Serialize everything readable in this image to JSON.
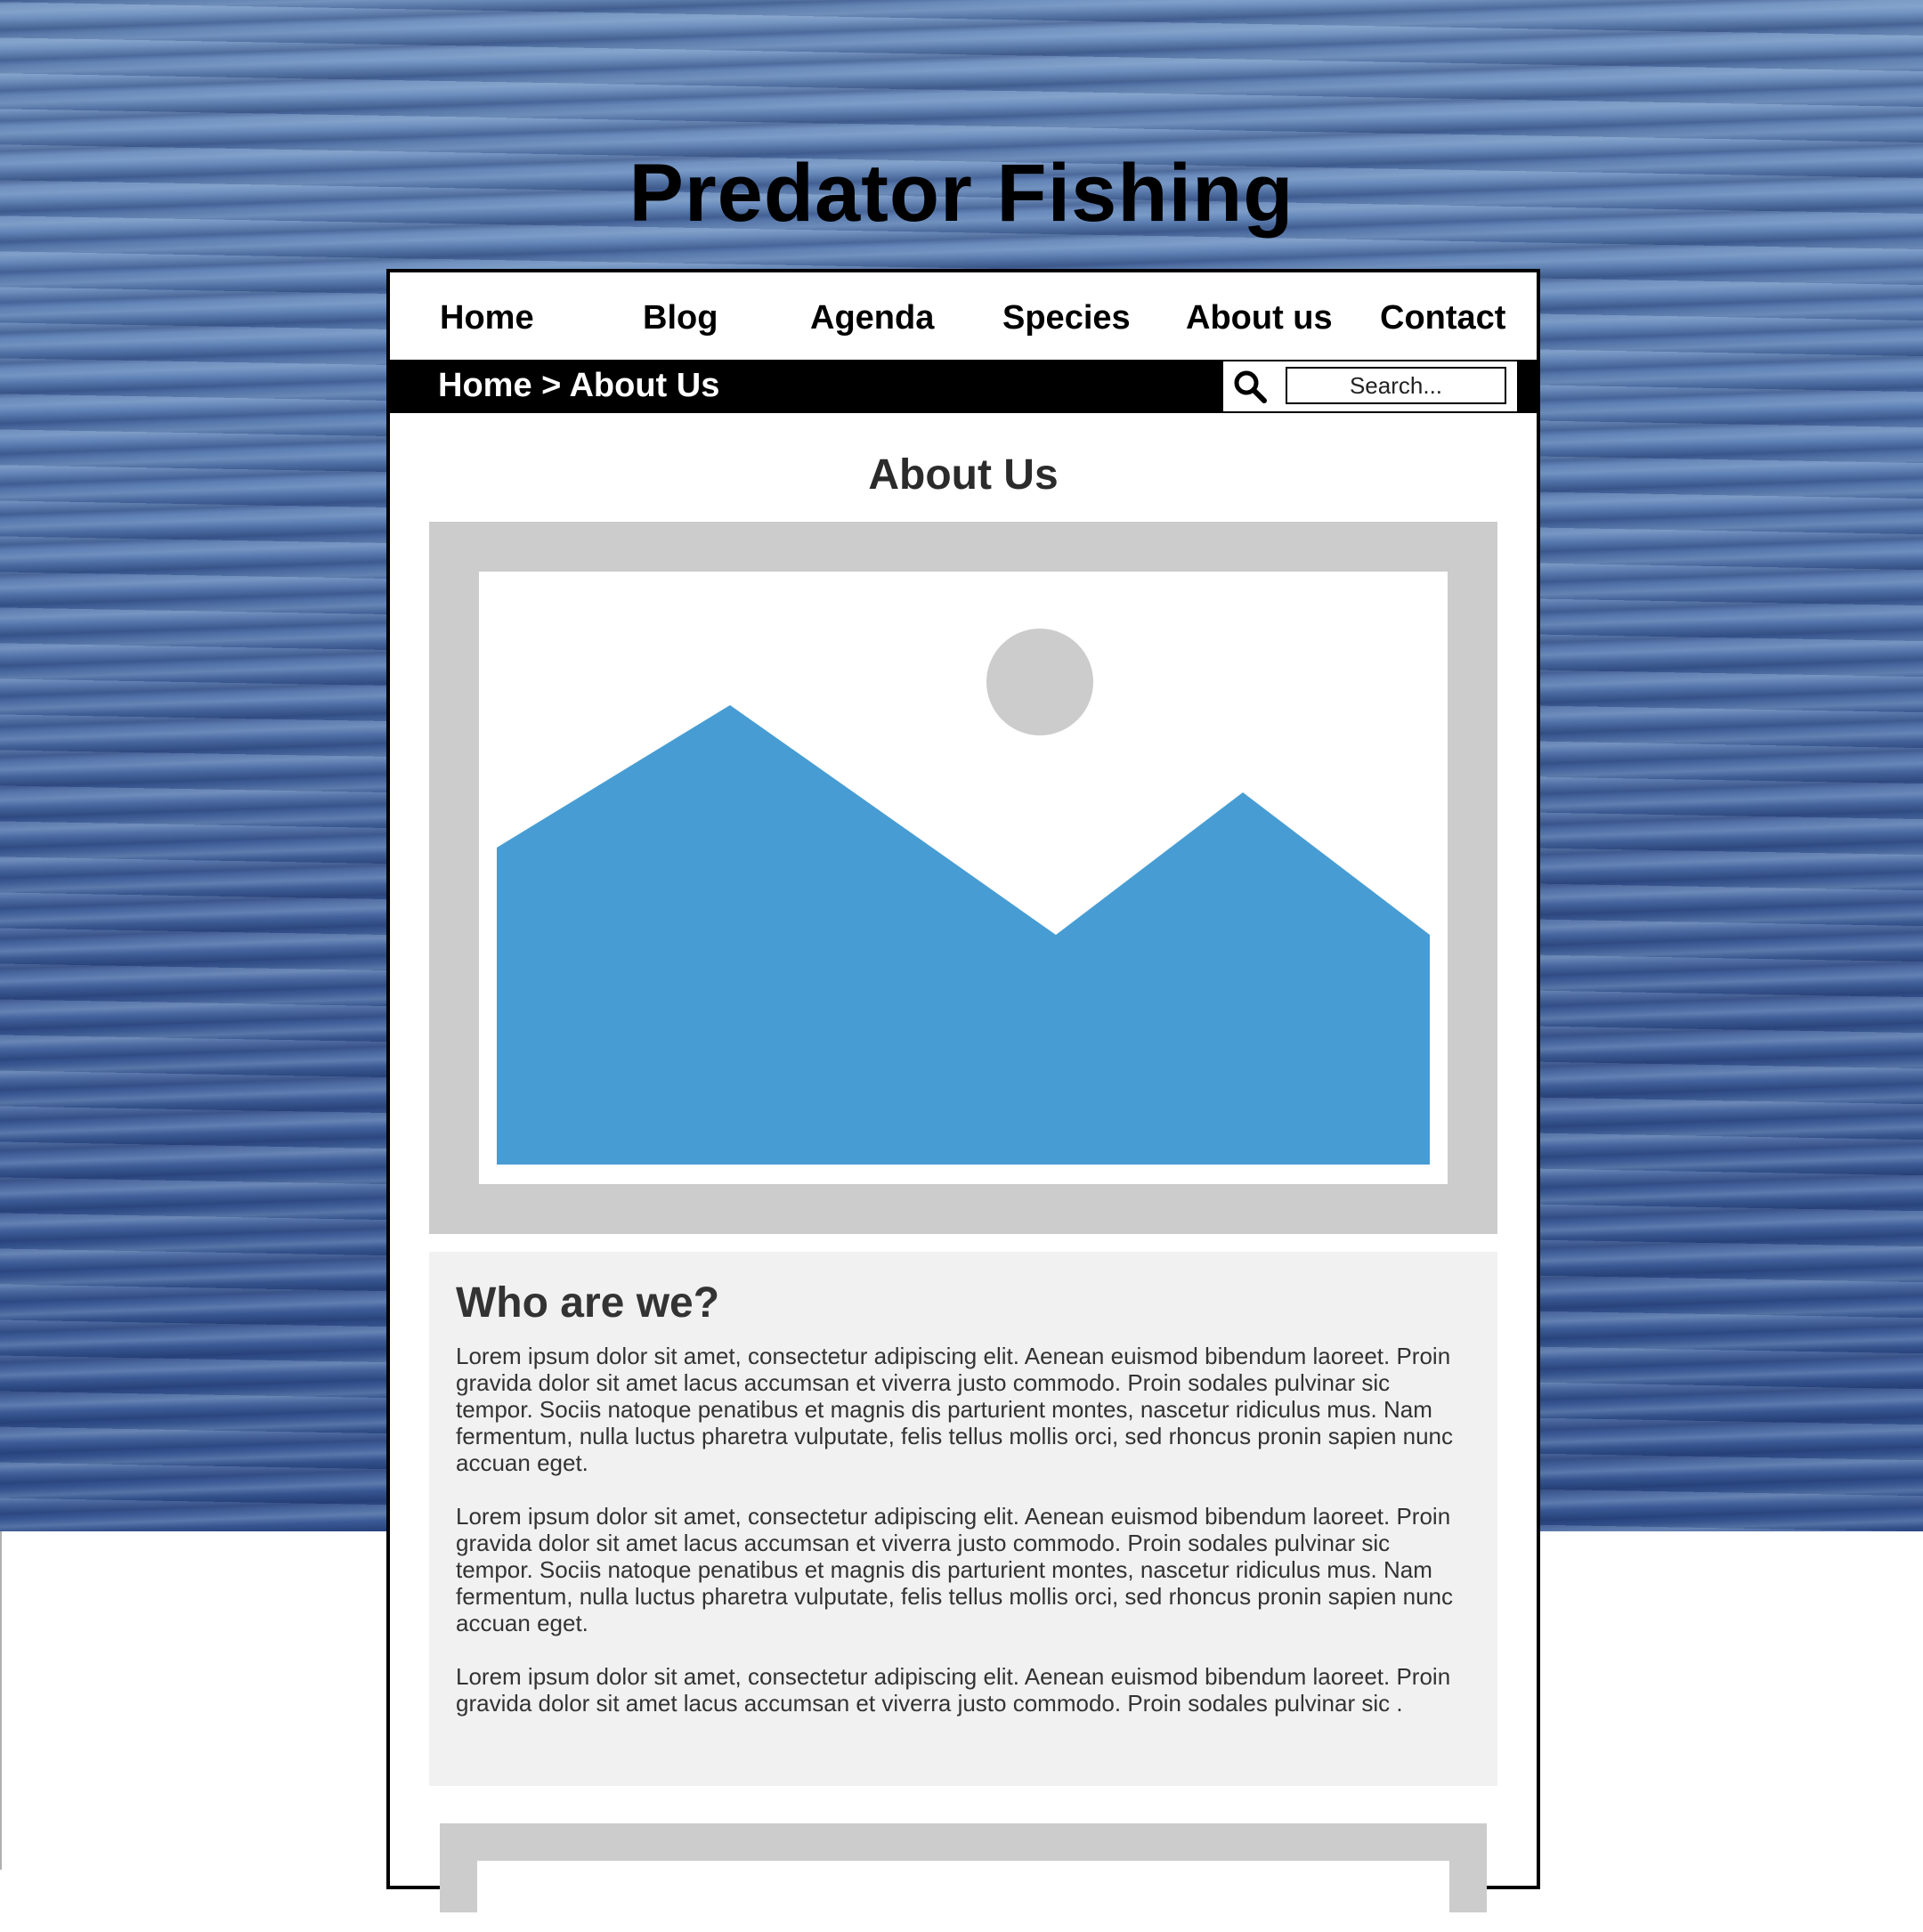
{
  "site": {
    "title": "Predator Fishing"
  },
  "nav": {
    "items": [
      {
        "label": "Home"
      },
      {
        "label": "Blog"
      },
      {
        "label": "Agenda"
      },
      {
        "label": "Species"
      },
      {
        "label": "About us"
      },
      {
        "label": "Contact"
      }
    ]
  },
  "breadcrumb": {
    "text": "Home > About Us"
  },
  "search": {
    "placeholder": "Search...",
    "icon": "magnifier"
  },
  "page": {
    "heading": "About Us",
    "hero_image": {
      "kind": "image-placeholder",
      "colors": {
        "frame": "#cccccc",
        "mountains": "#479dd3",
        "sun": "#cccccc"
      }
    }
  },
  "about": {
    "heading": "Who are we?",
    "paragraphs": [
      "Lorem ipsum dolor sit amet, consectetur adipiscing elit. Aenean euismod bibendum laoreet. Proin gravida dolor sit amet lacus accumsan et viverra justo commodo. Proin sodales pulvinar sic tempor. Sociis natoque penatibus et magnis dis parturient montes, nascetur ridiculus mus. Nam fermentum, nulla luctus pharetra vulputate, felis tellus mollis orci, sed rhoncus pronin sapien nunc accuan eget.",
      "Lorem ipsum dolor sit amet, consectetur adipiscing elit. Aenean euismod bibendum laoreet. Proin gravida dolor sit amet lacus accumsan et viverra justo commodo. Proin sodales pulvinar sic tempor. Sociis natoque penatibus et magnis dis parturient montes, nascetur ridiculus mus. Nam fermentum, nulla luctus pharetra vulputate, felis tellus mollis orci, sed rhoncus pronin sapien nunc accuan eget.",
      "Lorem ipsum dolor sit amet, consectetur adipiscing elit. Aenean euismod bibendum laoreet. Proin gravida dolor sit amet lacus accumsan et viverra justo commodo. Proin sodales pulvinar sic ."
    ]
  }
}
